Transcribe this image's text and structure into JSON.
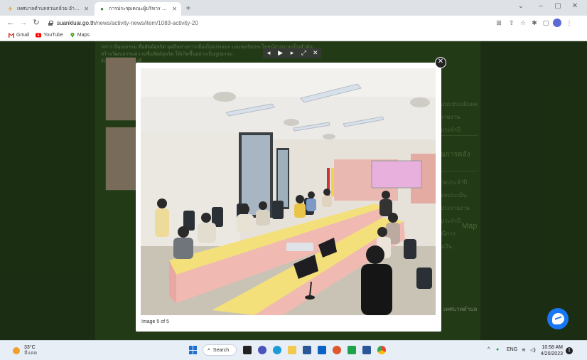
{
  "browser": {
    "tabs": [
      {
        "label": "เทศบาลตำบลสวนกล้วย อำเภอบ้านโป่ง",
        "favicon": "bird-favicon-icon",
        "active": false
      },
      {
        "label": "การประชุมคณะผู้บริหาร พนักงานเทศบาล",
        "favicon": "site-favicon-icon",
        "active": true
      }
    ],
    "new_tab": "+",
    "window_controls": {
      "minimize": "–",
      "maximize": "▢",
      "close": "✕",
      "dropdown": "⌄"
    },
    "url_host": "suankluai.go.th",
    "url_path": "/news/activity-news/item/1083-activity-20",
    "bookmarks": [
      {
        "label": "Gmail",
        "icon": "gmail-icon"
      },
      {
        "label": "YouTube",
        "icon": "youtube-icon"
      },
      {
        "label": "Maps",
        "icon": "maps-icon"
      }
    ]
  },
  "page": {
    "intro_text_1": "กล่าว มีคุณธรรม ซื่อสัตย์สุจริต จุดยืนทางการเมืองไม่แบ่งแยก และขอรับประโยชน์ส่วนรวมเป็นสำคัญ",
    "intro_text_2": "สร้างวัฒนธรรมความซื่อสัตย์สุจริต ให้เกิดขึ้นอย่างเป็นรูปธรรม",
    "intro_text_3": "รับผิดชอบต่อหน้าที่",
    "sidebar_links": [
      "แบบประเมินผล",
      "รายงาน",
      "ประจำปี",
      "นการคลัง",
      "ายประจำปี",
      "ผลประเมิน",
      "ประรายงาน",
      "ประจำปี",
      "ณีการ",
      "งเงิน"
    ],
    "map_label": "Map",
    "map_place": "เทศบาลตำบล"
  },
  "lightbox": {
    "controls": {
      "prev": "◂",
      "play": "▶",
      "next": "▸",
      "fullscreen": "⤢",
      "close": "✕"
    },
    "close_label": "✕",
    "caption": "Image 5 of 5"
  },
  "taskbar": {
    "temperature": "33°C",
    "weather_desc": "มีแดด",
    "search_label": "Search",
    "language": "ENG",
    "time": "10:58 AM",
    "date": "4/20/2023",
    "notification_count": "1"
  },
  "colors": {
    "page_bg": "#2c4a1d",
    "chat_bubble": "#1877f2",
    "windows_blue": "#1f6fd1"
  }
}
